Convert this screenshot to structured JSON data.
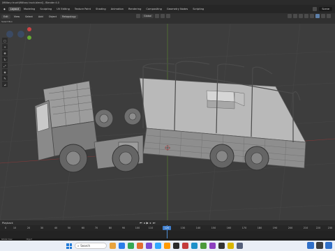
{
  "window": {
    "title": "\\Military truck\\Military truck.blend] - Blender 4.0"
  },
  "menubar": {
    "workspaces": [
      "Layout",
      "Modeling",
      "Sculpting",
      "UV Editing",
      "Texture Paint",
      "Shading",
      "Animation",
      "Rendering",
      "Compositing",
      "Geometry Nodes",
      "Scripting"
    ],
    "active_workspace": "Layout",
    "scene_label": "Scene"
  },
  "header": {
    "mode": "Edit",
    "view_menu": "View",
    "select_menu": "Select",
    "add_menu": "Add",
    "object_menu": "Object",
    "orientation": "Global",
    "retopo": "Retopology"
  },
  "subheader": {
    "label": "Select Box"
  },
  "timeline": {
    "ticks": [
      "0",
      "10",
      "20",
      "30",
      "40",
      "50",
      "60",
      "70",
      "80",
      "90",
      "100",
      "110",
      "120",
      "130",
      "140",
      "150",
      "160",
      "170",
      "180",
      "190",
      "200",
      "210",
      "220",
      "230"
    ],
    "current_frame": "120",
    "controls_label": "Playback"
  },
  "statusbar": {
    "left": "Rotate View",
    "middle": "Object"
  },
  "taskbar": {
    "search_placeholder": "Search"
  },
  "colors": {
    "viewport_bg": "#3d3d3d",
    "accent": "#4c8ed6",
    "active_workspace": "#4a4a4a"
  }
}
